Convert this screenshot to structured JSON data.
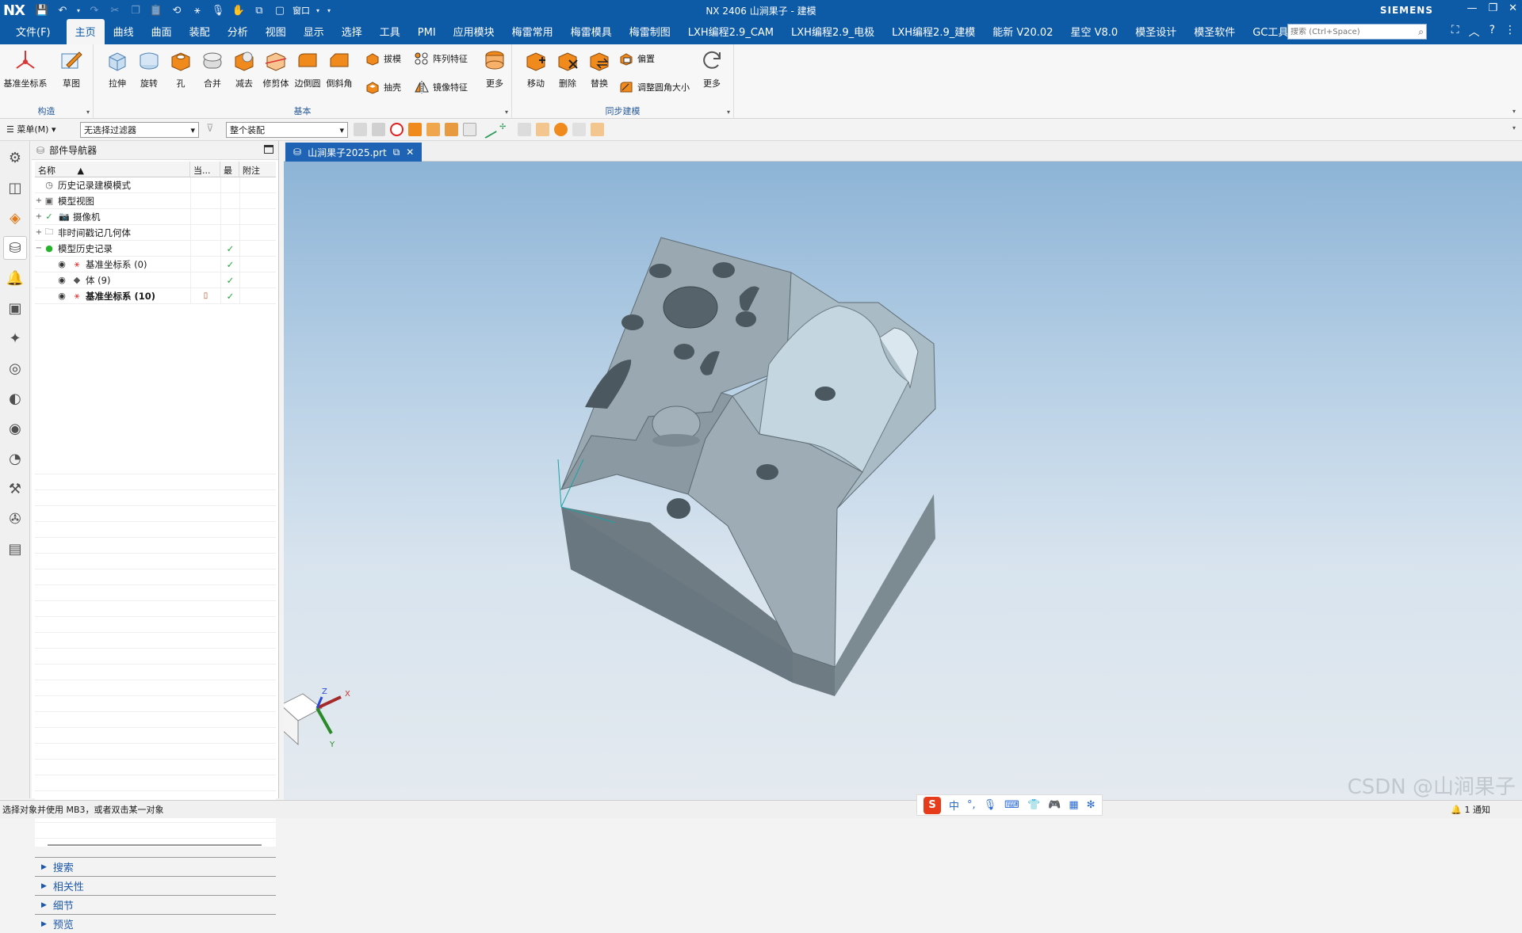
{
  "titlebar": {
    "logo": "NX",
    "window_title": "NX 2406 山涧果子 - 建模",
    "brand": "SIEMENS",
    "window_menu_label": "窗口"
  },
  "menubar": {
    "items": [
      "文件(F)",
      "主页",
      "曲线",
      "曲面",
      "装配",
      "分析",
      "视图",
      "显示",
      "选择",
      "工具",
      "PMI",
      "应用模块",
      "梅雷常用",
      "梅雷模具",
      "梅雷制图",
      "LXH编程2.9_CAM",
      "LXH编程2.9_电极",
      "LXH编程2.9_建模",
      "能新 V20.02",
      "星空 V8.0",
      "模圣设计",
      "模圣软件",
      "GC工具箱"
    ],
    "active_index": 1,
    "search_placeholder": "搜索 (Ctrl+Space)"
  },
  "ribbon": {
    "groups": {
      "construct": "构造",
      "basic": "基本",
      "sync": "同步建模"
    },
    "construct_tools": [
      "基准坐标系",
      "草图"
    ],
    "basic_tools": [
      "拉伸",
      "旋转",
      "孔",
      "合并",
      "减去",
      "修剪体",
      "边倒圆",
      "倒斜角"
    ],
    "basic_small": [
      "拔模",
      "抽壳",
      "阵列特征",
      "镜像特征"
    ],
    "basic_more": "更多",
    "sync_tools": [
      "移动",
      "删除",
      "替换"
    ],
    "sync_small": [
      "偏置",
      "调整圆角大小"
    ],
    "sync_more": "更多"
  },
  "selectionbar": {
    "menu_label": "菜单(M)",
    "filter_value": "无选择过滤器",
    "scope_value": "整个装配"
  },
  "navigator": {
    "title": "部件导航器",
    "columns": [
      "名称",
      "当...",
      "最",
      "附注"
    ],
    "rows": [
      {
        "label": "历史记录建模模式",
        "icon": "clock-icon",
        "expand": "",
        "indent": 0,
        "current": "",
        "latest": "",
        "bold": false
      },
      {
        "label": "模型视图",
        "icon": "model-view-icon",
        "expand": "+",
        "indent": 0,
        "current": "",
        "latest": "",
        "bold": false
      },
      {
        "label": "摄像机",
        "icon": "camera-icon",
        "expand": "+",
        "indent": 0,
        "current": "",
        "latest": "",
        "bold": false
      },
      {
        "label": "非时间戳记几何体",
        "icon": "folder-icon",
        "expand": "+",
        "indent": 0,
        "current": "",
        "latest": "",
        "bold": false
      },
      {
        "label": "模型历史记录",
        "icon": "history-icon",
        "expand": "−",
        "indent": 0,
        "current": "",
        "latest": "✓",
        "bold": false
      },
      {
        "label": "基准坐标系 (0)",
        "icon": "datum-csys-icon",
        "expand": "",
        "indent": 1,
        "current": "",
        "latest": "✓",
        "bold": false
      },
      {
        "label": "体 (9)",
        "icon": "body-icon",
        "expand": "",
        "indent": 1,
        "current": "",
        "latest": "✓",
        "bold": false
      },
      {
        "label": "基准坐标系 (10)",
        "icon": "datum-csys-icon",
        "expand": "",
        "indent": 1,
        "current": "▯",
        "latest": "✓",
        "bold": true
      }
    ],
    "sections": [
      "搜索",
      "相关性",
      "细节",
      "预览"
    ]
  },
  "document_tab": {
    "label": "山涧果子2025.prt"
  },
  "triad_labels": {
    "x": "X",
    "y": "Y",
    "z": "Z"
  },
  "statusbar": {
    "message": "选择对象并使用 MB3，或者双击某一对象",
    "notification": "1 通知"
  },
  "ime": {
    "lang": "中"
  },
  "watermark": "CSDN @山涧果子",
  "colors": {
    "title_blue": "#0d5aa7",
    "accent_orange": "#f08a1c",
    "check_green": "#1faa3b",
    "part_gray": "#95a4ad"
  }
}
